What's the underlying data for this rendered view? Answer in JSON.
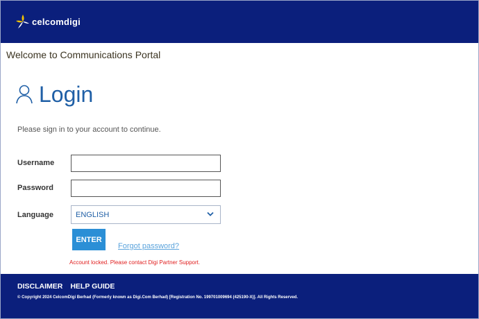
{
  "header": {
    "brand": "celcomdigi"
  },
  "page": {
    "welcome": "Welcome to Communications Portal"
  },
  "login": {
    "title": "Login",
    "subtitle": "Please sign in to your account to continue.",
    "username_label": "Username",
    "username_value": "",
    "password_label": "Password",
    "password_value": "",
    "language_label": "Language",
    "language_value": "ENGLISH",
    "enter_label": "ENTER",
    "forgot_label": "Forgot password?",
    "error_message": "Account locked. Please contact Digi Partner Support."
  },
  "footer": {
    "disclaimer": "DISCLAIMER",
    "help_guide": "HELP GUIDE",
    "copyright": "© Copyright 2024 CelcomDigi Berhad (Formerly known as Digi.Com Berhad) [Registration No. 199701009694 (425190-X)]. All Rights Reserved."
  },
  "colors": {
    "brand_navy": "#0b1f7c",
    "accent_blue": "#2b8fd6",
    "title_blue": "#1f5fa6",
    "error_red": "#e02020",
    "logo_yellow": "#f5c400"
  },
  "icons": [
    "celcomdigi-logo-icon",
    "user-icon",
    "chevron-down-icon"
  ]
}
